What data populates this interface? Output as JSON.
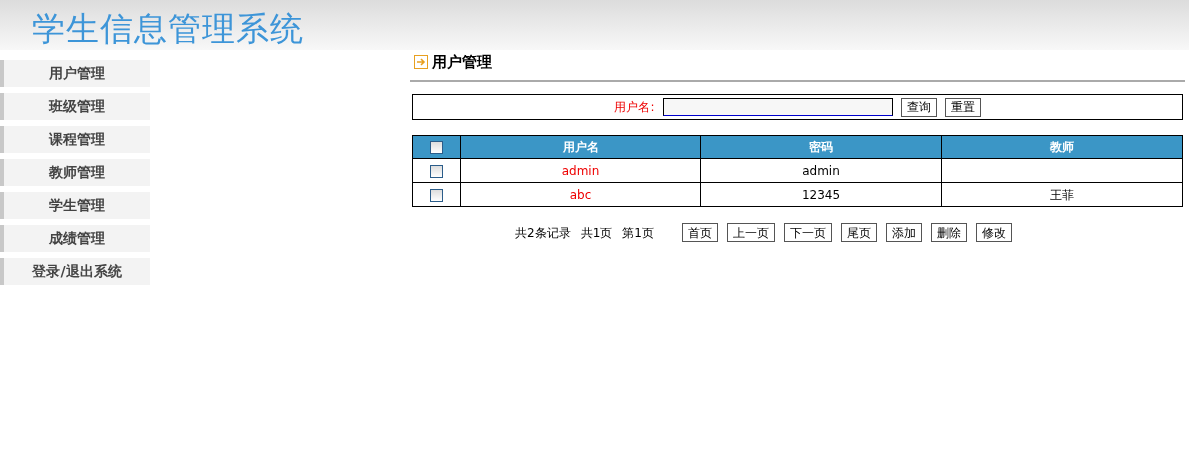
{
  "header": {
    "title": "学生信息管理系统"
  },
  "sidebar": {
    "items": [
      {
        "label": "用户管理"
      },
      {
        "label": "班级管理"
      },
      {
        "label": "课程管理"
      },
      {
        "label": "教师管理"
      },
      {
        "label": "学生管理"
      },
      {
        "label": "成绩管理"
      },
      {
        "label": "登录/退出系统"
      }
    ]
  },
  "page_title": "用户管理",
  "search": {
    "label": "用户名:",
    "buttons": [
      "查询",
      "重置"
    ]
  },
  "table": {
    "header_checked": false,
    "columns": [
      "用户名",
      "密码",
      "教师"
    ],
    "rows": [
      {
        "checked": false,
        "cells": [
          "admin",
          "admin",
          null
        ]
      },
      {
        "checked": false,
        "cells": [
          "abc",
          "12345",
          "王菲"
        ]
      }
    ]
  },
  "pager": {
    "summary": [
      "共2条记录",
      "共1页",
      "第1页"
    ],
    "buttons": [
      "首页",
      "上一页",
      "下一页",
      "尾页",
      "添加",
      "删除",
      "修改"
    ]
  }
}
